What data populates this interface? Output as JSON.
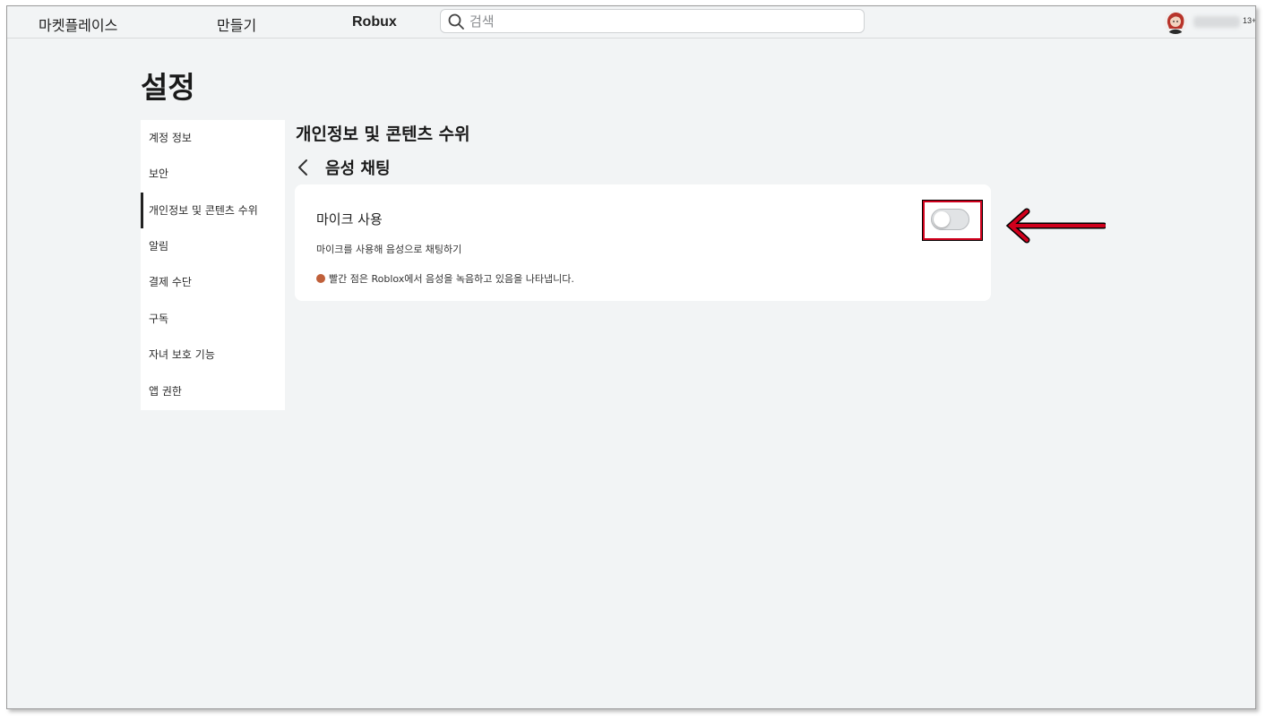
{
  "nav": {
    "marketplace": "마켓플레이스",
    "create": "만들기",
    "robux": "Robux",
    "search_placeholder": "검색",
    "age_badge": "13+"
  },
  "page": {
    "title": "설정"
  },
  "sidebar": {
    "items": [
      {
        "label": "계정 정보"
      },
      {
        "label": "보안"
      },
      {
        "label": "개인정보 및 콘텐츠 수위",
        "active": true
      },
      {
        "label": "알림"
      },
      {
        "label": "결제 수단"
      },
      {
        "label": "구독"
      },
      {
        "label": "자녀 보호 기능"
      },
      {
        "label": "앱 권한"
      }
    ]
  },
  "content": {
    "section_title": "개인정보 및 콘텐츠 수위",
    "subsection_title": "음성 채팅",
    "mic": {
      "title": "마이크 사용",
      "description": "마이크를 사용해 음성으로 채팅하기",
      "notice": "빨간 점은 Roblox에서 음성을 녹음하고 있음을 나타냅니다.",
      "enabled": false
    }
  },
  "annotations": {
    "highlight_color": "#d0001c"
  },
  "icons": {
    "search": "search-icon",
    "back": "chevron-left-icon",
    "avatar": "avatar",
    "arrow": "arrow-left-icon"
  }
}
